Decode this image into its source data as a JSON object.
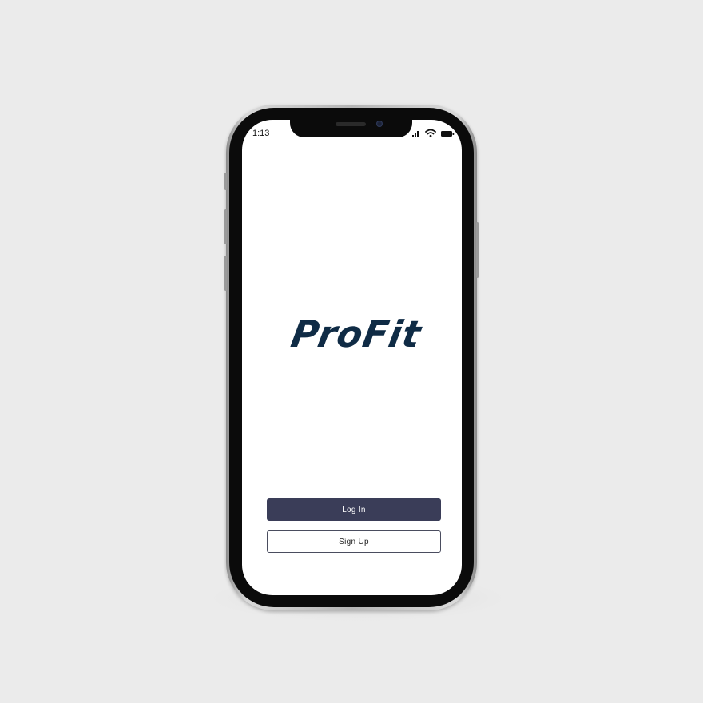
{
  "status_bar": {
    "time": "1:13",
    "icons": [
      "cellular-signal-icon",
      "wifi-icon",
      "battery-icon"
    ]
  },
  "app": {
    "logo_text": "ProFit",
    "logo_color": "#0f2b45"
  },
  "buttons": {
    "login_label": "Log In",
    "signup_label": "Sign Up",
    "login_color": "#3a3d58"
  }
}
